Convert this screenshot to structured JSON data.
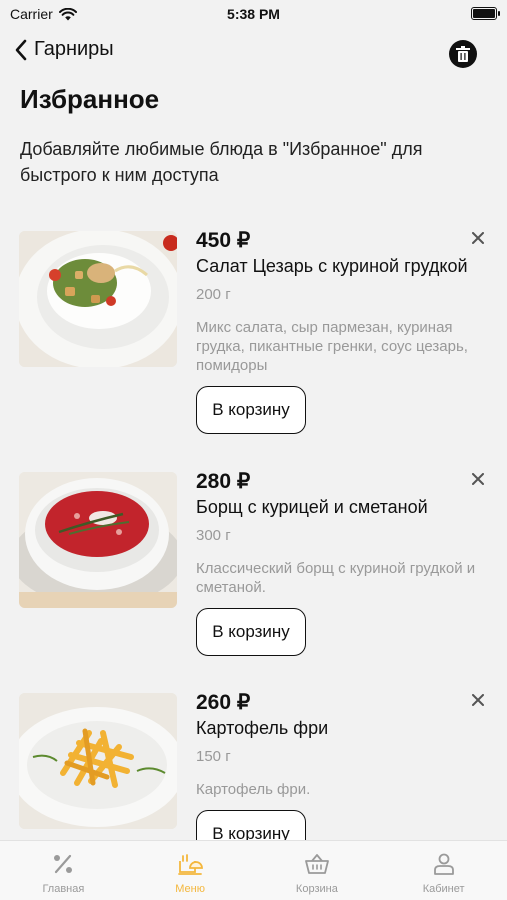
{
  "status_bar": {
    "carrier": "Carrier",
    "time": "5:38 PM"
  },
  "nav": {
    "back_label": "Гарниры"
  },
  "page": {
    "title": "Избранное",
    "subtitle": "Добавляйте любимые блюда в \"Избранное\" для быстрого к ним доступа"
  },
  "items": [
    {
      "price": "450 ₽",
      "name": "Салат Цезарь с куриной грудкой",
      "weight": "200 г",
      "description": "Микс салата, сыр пармезан, куриная грудка, пикантные гренки, соус цезарь, помидоры",
      "button": "В корзину"
    },
    {
      "price": "280 ₽",
      "name": "Борщ с курицей и сметаной",
      "weight": "300 г",
      "description": "Классический борщ с куриной грудкой и сметаной.",
      "button": "В корзину"
    },
    {
      "price": "260 ₽",
      "name": "Картофель фри",
      "weight": "150 г",
      "description": "Картофель фри.",
      "button": "В корзину"
    }
  ],
  "tabs": [
    {
      "label": "Главная",
      "icon": "discount-icon",
      "active": false
    },
    {
      "label": "Меню",
      "icon": "chef-hat-icon",
      "active": true
    },
    {
      "label": "Корзина",
      "icon": "basket-icon",
      "active": false
    },
    {
      "label": "Кабинет",
      "icon": "user-icon",
      "active": false
    }
  ],
  "colors": {
    "accent": "#f4b73d",
    "background": "#f2f2f2",
    "muted_text": "#999999"
  }
}
